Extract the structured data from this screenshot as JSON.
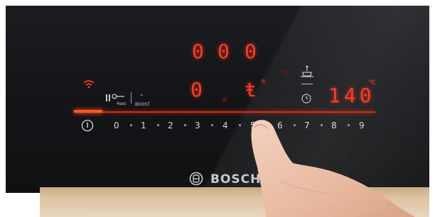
{
  "timer": {
    "digits": [
      "0",
      "0",
      "0"
    ]
  },
  "zone": {
    "level": "0",
    "mode_char": "ŧ"
  },
  "temperature": {
    "value": "140",
    "unit": "°C"
  },
  "controls": {
    "lock_duration": "4sec",
    "boost_label": "BOOST"
  },
  "power_scale": [
    "0",
    "1",
    "2",
    "3",
    "4",
    "5",
    "6",
    "7",
    "8",
    "9"
  ],
  "brand": {
    "name": "BOSCH"
  },
  "colors": {
    "display": "#ff3a24",
    "glass": "#141518",
    "slider_bar": "#d52b1a",
    "counter": "#ddc3a2"
  }
}
